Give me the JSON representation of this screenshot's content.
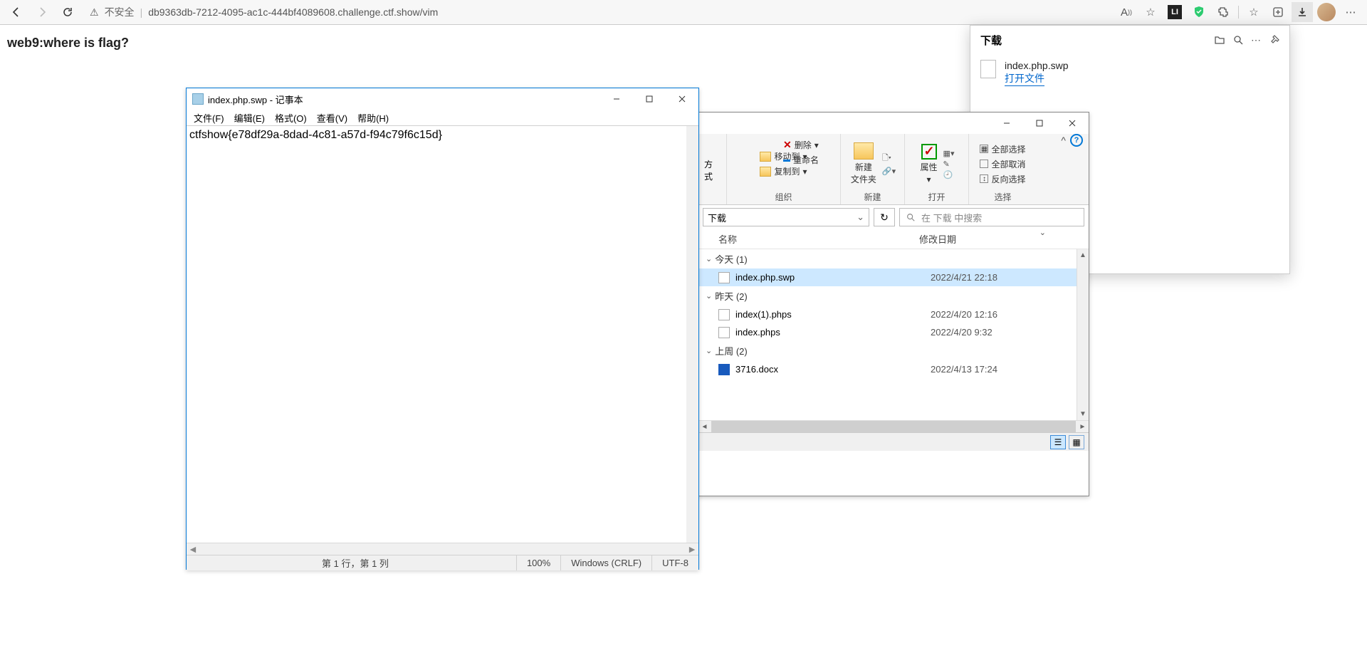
{
  "browser": {
    "insecure_label": "不安全",
    "url": "db9363db-7212-4095-ac1c-444bf4089608.challenge.ctf.show/vim",
    "ext_label": "LI"
  },
  "page": {
    "text": "web9:where is flag?"
  },
  "downloads": {
    "title": "下载",
    "file_name": "index.php.swp",
    "open_file": "打开文件"
  },
  "notepad": {
    "title": "index.php.swp - 记事本",
    "menu": {
      "file": "文件(F)",
      "edit": "编辑(E)",
      "format": "格式(O)",
      "view": "查看(V)",
      "help": "帮助(H)"
    },
    "content": "ctfshow{e78df29a-8dad-4c81-a57d-f94c79f6c15d}",
    "status": {
      "pos": "第 1 行，第 1 列",
      "zoom": "100%",
      "eol": "Windows (CRLF)",
      "enc": "UTF-8"
    }
  },
  "explorer": {
    "ribbon": {
      "method": "方式",
      "move_to": "移动到",
      "copy_to": "复制到",
      "delete": "删除",
      "rename": "重命名",
      "organize": "组织",
      "new_folder": "新建\n文件夹",
      "new": "新建",
      "properties": "属性",
      "open": "打开",
      "select_all": "全部选择",
      "select_none": "全部取消",
      "invert": "反向选择",
      "select": "选择"
    },
    "path_label": "下载",
    "search_placeholder": "在 下载 中搜索",
    "columns": {
      "name": "名称",
      "date": "修改日期"
    },
    "groups": [
      {
        "label": "今天 (1)",
        "files": [
          {
            "name": "index.php.swp",
            "date": "2022/4/21 22:18",
            "selected": true,
            "icon": "file"
          }
        ]
      },
      {
        "label": "昨天 (2)",
        "files": [
          {
            "name": "index(1).phps",
            "date": "2022/4/20 12:16",
            "icon": "file"
          },
          {
            "name": "index.phps",
            "date": "2022/4/20 9:32",
            "icon": "file"
          }
        ]
      },
      {
        "label": "上周 (2)",
        "files": [
          {
            "name": "3716.docx",
            "date": "2022/4/13 17:24",
            "icon": "word"
          }
        ]
      }
    ]
  }
}
